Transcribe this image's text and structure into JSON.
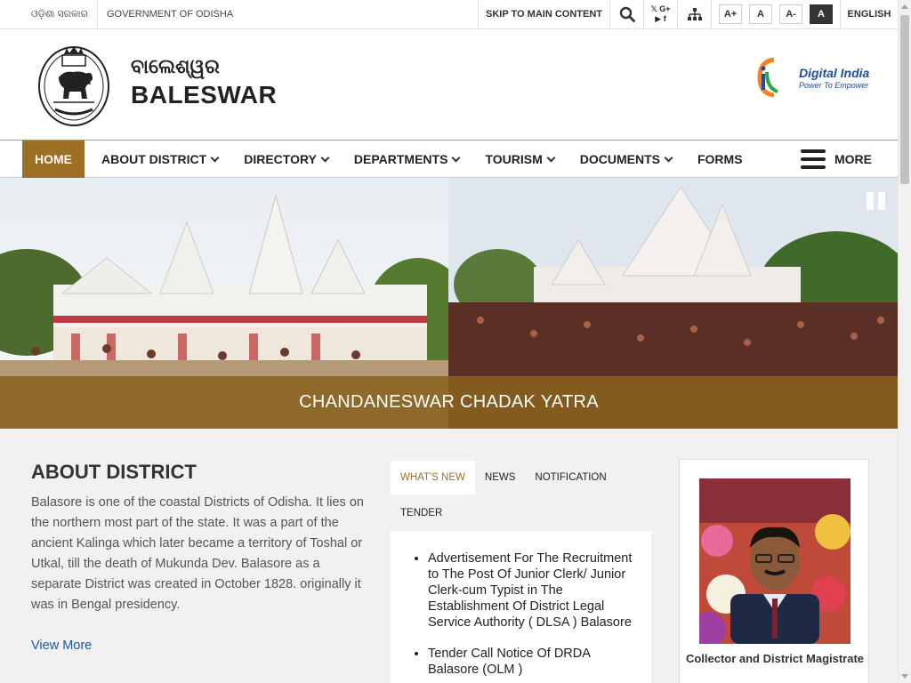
{
  "topbar": {
    "odia_govt": "ଓଡ଼ିଶା ସରକାର",
    "govt_label": "GOVERNMENT OF ODISHA",
    "skip_label": "SKIP TO MAIN CONTENT",
    "social_top": "𝕏 G+",
    "social_bottom": "▶ f",
    "font_sizes": [
      "A+",
      "A",
      "A-",
      "A"
    ],
    "language": "ENGLISH",
    "icons": [
      "search-icon",
      "social-icon",
      "sitemap-icon"
    ]
  },
  "header": {
    "odia_name": "ବାଲେଶ୍ୱର",
    "site_name": "BALESWAR",
    "logo": "emblem-of-odisha",
    "partner_logo_line1": "Digital India",
    "partner_logo_line2": "Power To Empower"
  },
  "nav": {
    "items": [
      {
        "label": "HOME",
        "active": true,
        "dropdown": false
      },
      {
        "label": "ABOUT DISTRICT",
        "dropdown": true
      },
      {
        "label": "DIRECTORY",
        "dropdown": true
      },
      {
        "label": "DEPARTMENTS",
        "dropdown": true
      },
      {
        "label": "TOURISM",
        "dropdown": true
      },
      {
        "label": "DOCUMENTS",
        "dropdown": true
      },
      {
        "label": "FORMS",
        "dropdown": false
      }
    ],
    "more_label": "MORE"
  },
  "banner": {
    "caption": "CHANDANESWAR CHADAK YATRA"
  },
  "about": {
    "heading": "ABOUT DISTRICT",
    "body": "Balasore is one of the coastal Districts of Odisha. It lies on the northern most part of the state. It was a part of the ancient Kalinga which later became a territory of Toshal or Utkal, till the death of Mukunda Dev. Balasore as a separate District was created in October 1828. originally it was in Bengal presidency.",
    "link": "View More"
  },
  "news": {
    "tabs": [
      "WHAT'S NEW",
      "NEWS",
      "NOTIFICATION",
      "TENDER"
    ],
    "items": [
      "Advertisement For The Recruitment to The Post Of Junior Clerk/ Junior Clerk-cum Typist in The Establishment Of District Legal Service Authority ( DLSA ) Balasore",
      "Tender Call Notice Of DRDA Balasore (OLM )"
    ]
  },
  "collector": {
    "title": "Collector and District Magistrate"
  },
  "colors": {
    "accent": "#9c6f24",
    "link": "#1a5aa6",
    "caption_bg": "#8a621e"
  }
}
